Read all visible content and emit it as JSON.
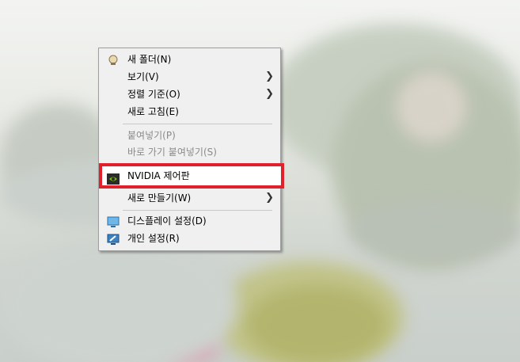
{
  "menu": {
    "items": [
      {
        "label": "새 폴더(N)",
        "icon": "new-folder-icon",
        "disabled": false,
        "submenu": false
      },
      {
        "label": "보기(V)",
        "icon": null,
        "disabled": false,
        "submenu": true
      },
      {
        "label": "정렬 기준(O)",
        "icon": null,
        "disabled": false,
        "submenu": true
      },
      {
        "label": "새로 고침(E)",
        "icon": null,
        "disabled": false,
        "submenu": false
      },
      {
        "label": "붙여넣기(P)",
        "icon": null,
        "disabled": true,
        "submenu": false
      },
      {
        "label": "바로 가기 붙여넣기(S)",
        "icon": null,
        "disabled": true,
        "submenu": false
      },
      {
        "label": "NVIDIA 제어판",
        "icon": "nvidia-icon",
        "disabled": false,
        "submenu": false,
        "highlighted": true
      },
      {
        "label": "새로 만들기(W)",
        "icon": null,
        "disabled": false,
        "submenu": true
      },
      {
        "label": "디스플레이 설정(D)",
        "icon": "display-settings-icon",
        "disabled": false,
        "submenu": false
      },
      {
        "label": "개인 설정(R)",
        "icon": "personalize-icon",
        "disabled": false,
        "submenu": false
      }
    ]
  },
  "colors": {
    "highlight_border": "#e0202a",
    "menu_background": "#f0f0f0",
    "disabled_text": "#8a8a8a"
  }
}
